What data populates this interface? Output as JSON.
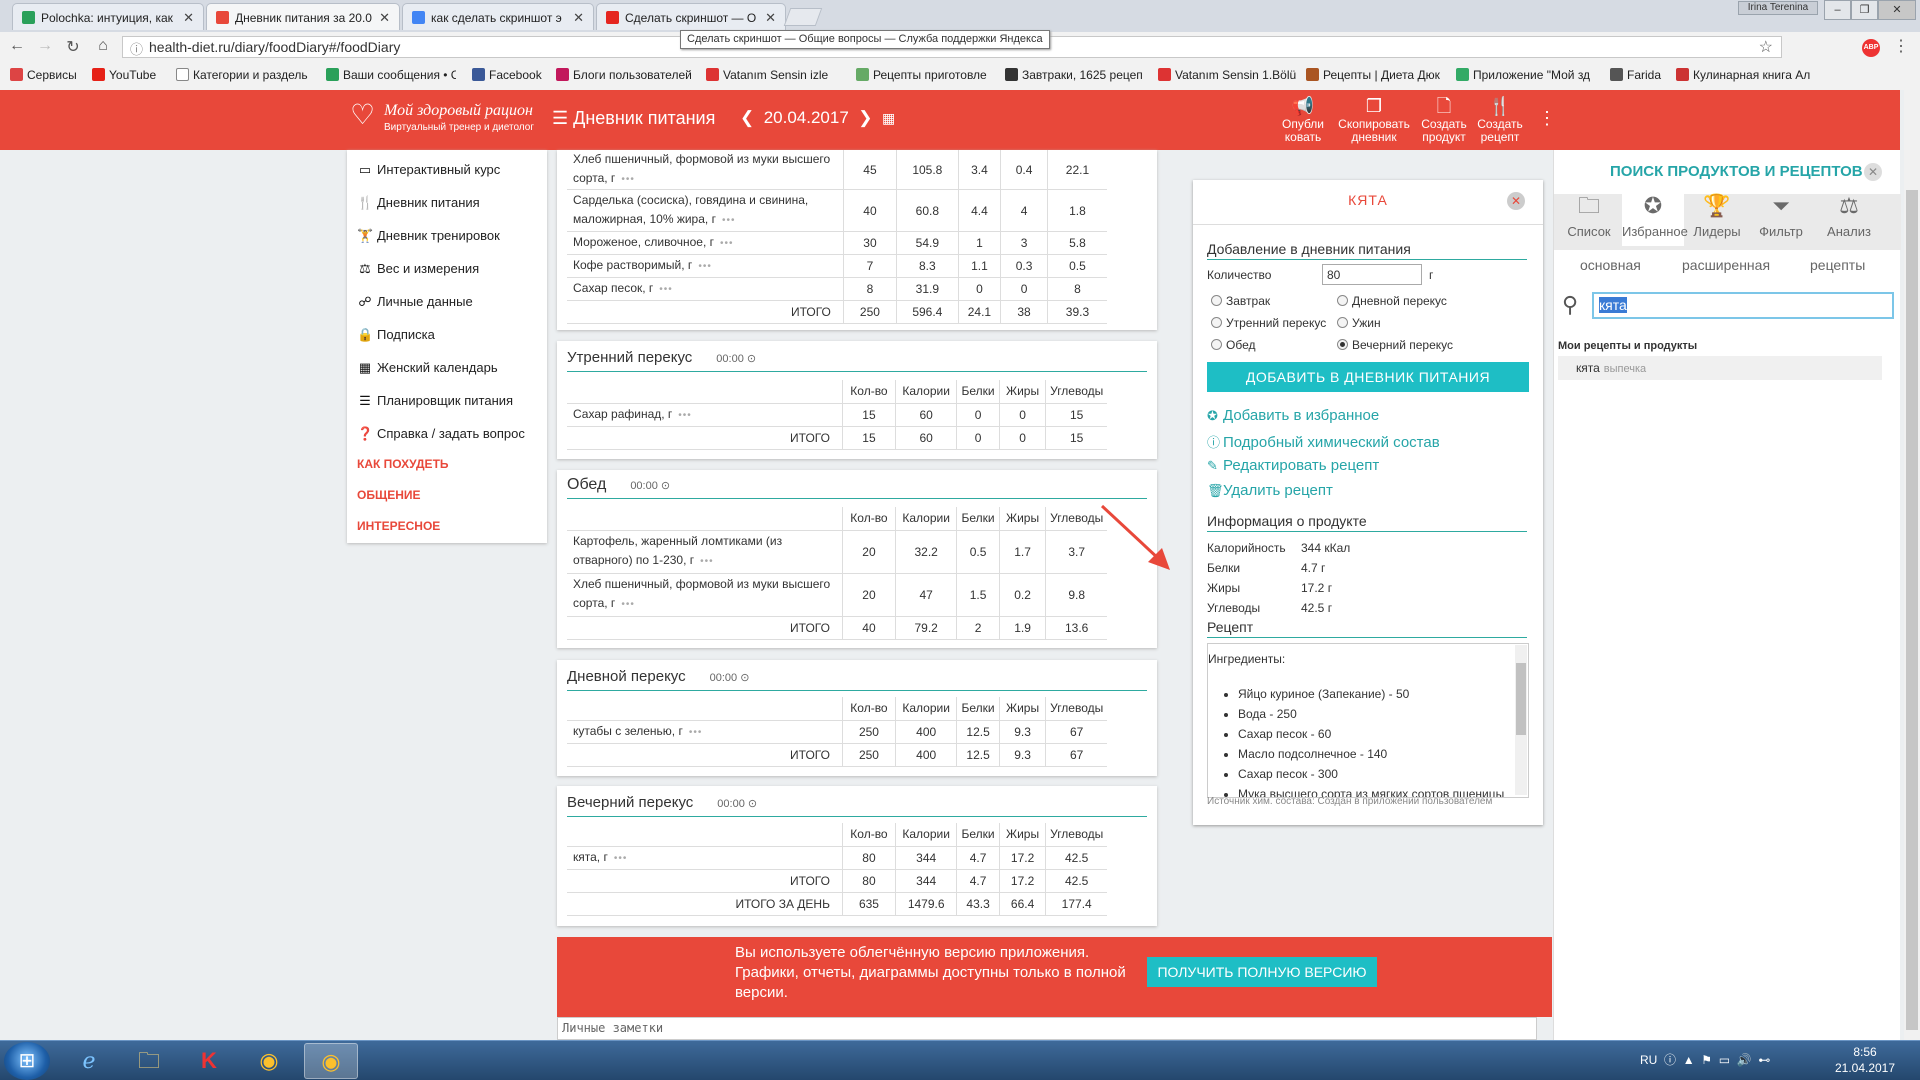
{
  "browser": {
    "tabs": [
      {
        "title": "Polochka: интуиция, как",
        "fav_color": "#2aa05a"
      },
      {
        "title": "Дневник питания за 20.0",
        "fav_color": "#e8483a"
      },
      {
        "title": "как сделать скриншот э",
        "fav_color": "#4285f4"
      },
      {
        "title": "Сделать скриншот — О",
        "fav_color": "#e52620"
      }
    ],
    "tooltip": "Сделать скриншот — Общие вопросы — Служба поддержки Яндекса",
    "user_label": "Irina Terenina",
    "address": "health-diet.ru/diary/foodDiary#/foodDiary",
    "bookmarks": [
      {
        "label": "Сервисы",
        "color": "#d44"
      },
      {
        "label": "YouTube",
        "color": "#e62117"
      },
      {
        "label": "Категории и раздель",
        "color": "#888"
      },
      {
        "label": "Ваши сообщения • С",
        "color": "#2aa05a"
      },
      {
        "label": "Facebook",
        "color": "#3b5998"
      },
      {
        "label": "Блоги пользователей",
        "color": "#c2185b"
      },
      {
        "label": "Vatanım Sensin izle",
        "color": "#d33"
      },
      {
        "label": "Рецепты приготовле",
        "color": "#6a6"
      },
      {
        "label": "Завтраки, 1625 рецеп",
        "color": "#333"
      },
      {
        "label": "Vatanım Sensin 1.Bölü",
        "color": "#d33"
      },
      {
        "label": "Рецепты | Диета Дюк",
        "color": "#a52"
      },
      {
        "label": "Приложение \"Мой зд",
        "color": "#3a6"
      },
      {
        "label": "Farida",
        "color": "#555"
      },
      {
        "label": "Кулинарная книга Ал",
        "color": "#c33"
      }
    ]
  },
  "header": {
    "logo_title": "Мой здоровый рацион",
    "logo_sub": "Виртуальный тренер и диетолог",
    "menu_label": "Дневник питания",
    "date": "20.04.2017",
    "actions": [
      {
        "l1": "Опубли",
        "l2": "ковать",
        "icon": "megaphone-icon"
      },
      {
        "l1": "Скопировать",
        "l2": "дневник",
        "icon": "copy-icon"
      },
      {
        "l1": "Создать",
        "l2": "продукт",
        "icon": "file-icon"
      },
      {
        "l1": "Создать",
        "l2": "рецепт",
        "icon": "utensils-icon"
      }
    ]
  },
  "sidebar": {
    "items": [
      {
        "label": "Интерактивный курс"
      },
      {
        "label": "Дневник питания"
      },
      {
        "label": "Дневник тренировок"
      },
      {
        "label": "Вес и измерения"
      },
      {
        "label": "Личные данные"
      },
      {
        "label": "Подписка"
      },
      {
        "label": "Женский календарь"
      },
      {
        "label": "Планировщик питания"
      },
      {
        "label": "Справка / задать вопрос"
      }
    ],
    "red_links": [
      "КАК ПОХУДЕТЬ",
      "ОБЩЕНИЕ",
      "ИНТЕРЕСНОЕ"
    ]
  },
  "columns": [
    "Кол-во",
    "Калории",
    "Белки",
    "Жиры",
    "Углеводы"
  ],
  "total_label": "ИТОГО",
  "day_total_label": "ИТОГО ЗА ДЕНЬ",
  "meals": {
    "top": {
      "rows": [
        {
          "name": "Хлеб пшеничный, формовой из муки высшего сорта, г",
          "qty": "45",
          "kcal": "105.8",
          "p": "3.4",
          "f": "0.4",
          "c": "22.1"
        },
        {
          "name": "Сарделька (сосиска), говядина и свинина, маложирная, 10% жира, г",
          "qty": "40",
          "kcal": "60.8",
          "p": "4.4",
          "f": "4",
          "c": "1.8"
        },
        {
          "name": "Мороженое, сливочное, г",
          "qty": "30",
          "kcal": "54.9",
          "p": "1",
          "f": "3",
          "c": "5.8"
        },
        {
          "name": "Кофе растворимый, г",
          "qty": "7",
          "kcal": "8.3",
          "p": "1.1",
          "f": "0.3",
          "c": "0.5"
        },
        {
          "name": "Сахар песок, г",
          "qty": "8",
          "kcal": "31.9",
          "p": "0",
          "f": "0",
          "c": "8"
        }
      ],
      "total": {
        "qty": "250",
        "kcal": "596.4",
        "p": "24.1",
        "f": "38",
        "c": "39.3"
      }
    },
    "snack1": {
      "title": "Утренний перекус",
      "time": "00:00",
      "rows": [
        {
          "name": "Сахар рафинад, г",
          "qty": "15",
          "kcal": "60",
          "p": "0",
          "f": "0",
          "c": "15"
        }
      ],
      "total": {
        "qty": "15",
        "kcal": "60",
        "p": "0",
        "f": "0",
        "c": "15"
      }
    },
    "lunch": {
      "title": "Обед",
      "time": "00:00",
      "rows": [
        {
          "name": "Картофель, жаренный ломтиками (из отварного) по 1-230, г",
          "qty": "20",
          "kcal": "32.2",
          "p": "0.5",
          "f": "1.7",
          "c": "3.7"
        },
        {
          "name": "Хлеб пшеничный, формовой из муки высшего сорта, г",
          "qty": "20",
          "kcal": "47",
          "p": "1.5",
          "f": "0.2",
          "c": "9.8"
        }
      ],
      "total": {
        "qty": "40",
        "kcal": "79.2",
        "p": "2",
        "f": "1.9",
        "c": "13.6"
      }
    },
    "snack2": {
      "title": "Дневной перекус",
      "time": "00:00",
      "rows": [
        {
          "name": "кутабы с зеленью, г",
          "qty": "250",
          "kcal": "400",
          "p": "12.5",
          "f": "9.3",
          "c": "67"
        }
      ],
      "total": {
        "qty": "250",
        "kcal": "400",
        "p": "12.5",
        "f": "9.3",
        "c": "67"
      }
    },
    "snack3": {
      "title": "Вечерний перекус",
      "time": "00:00",
      "rows": [
        {
          "name": "кята, г",
          "qty": "80",
          "kcal": "344",
          "p": "4.7",
          "f": "17.2",
          "c": "42.5"
        }
      ],
      "total": {
        "qty": "80",
        "kcal": "344",
        "p": "4.7",
        "f": "17.2",
        "c": "42.5"
      },
      "day": {
        "qty": "635",
        "kcal": "1479.6",
        "p": "43.3",
        "f": "66.4",
        "c": "177.4"
      }
    }
  },
  "detail": {
    "title": "КЯТА",
    "add_section": "Добавление в дневник питания",
    "qty_label": "Количество",
    "qty_value": "80",
    "qty_unit": "г",
    "meals_left": [
      "Завтрак",
      "Утренний перекус",
      "Обед"
    ],
    "meals_right": [
      "Дневной перекус",
      "Ужин",
      "Вечерний перекус"
    ],
    "add_button": "ДОБАВИТЬ В ДНЕВНИК ПИТАНИЯ",
    "links": [
      "Добавить в избранное",
      "Подробный химический состав",
      "Редактировать рецепт",
      "Удалить рецепт"
    ],
    "info_section": "Информация о продукте",
    "info": [
      {
        "k": "Калорийность",
        "v": "344 кКал"
      },
      {
        "k": "Белки",
        "v": "4.7 г"
      },
      {
        "k": "Жиры",
        "v": "17.2 г"
      },
      {
        "k": "Углеводы",
        "v": "42.5 г"
      }
    ],
    "recipe_section": "Рецепт",
    "ingredients_label": "Ингредиенты:",
    "ingredients": [
      "Яйцо куриное (Запекание) - 50",
      "Вода - 250",
      "Сахар песок - 60",
      "Масло подсолнечное - 140",
      "Сахар песок - 300",
      "Мука высшего сорта из мягких сортов пшеницы"
    ],
    "source": "Источник хим. состава: Создан в приложении пользователем"
  },
  "search_panel": {
    "title": "ПОИСК ПРОДУКТОВ И РЕЦЕПТОВ",
    "icons": [
      {
        "label": "Список",
        "icon": "folder-icon"
      },
      {
        "label": "Избранное",
        "icon": "star-icon"
      },
      {
        "label": "Лидеры",
        "icon": "trophy-icon"
      },
      {
        "label": "Фильтр",
        "icon": "filter-icon"
      },
      {
        "label": "Анализ",
        "icon": "scales-icon"
      }
    ],
    "tabs": [
      "основная",
      "расширенная",
      "рецепты"
    ],
    "query": "кята",
    "list_header": "Мои рецепты и продукты",
    "result_name": "кята",
    "result_type": "выпечка"
  },
  "banner": {
    "message": "Вы используете облегчённую версию приложения. Графики, отчеты, диаграммы доступны только в полной версии.",
    "button": "ПОЛУЧИТЬ ПОЛНУЮ ВЕРСИЮ"
  },
  "notes_placeholder": "Личные заметки",
  "taskbar": {
    "lang": "RU",
    "time": "8:56",
    "date": "21.04.2017"
  },
  "colors": {
    "accent_red": "#e8483a",
    "accent_teal": "#1ebec5",
    "link_teal": "#26a5a8"
  }
}
